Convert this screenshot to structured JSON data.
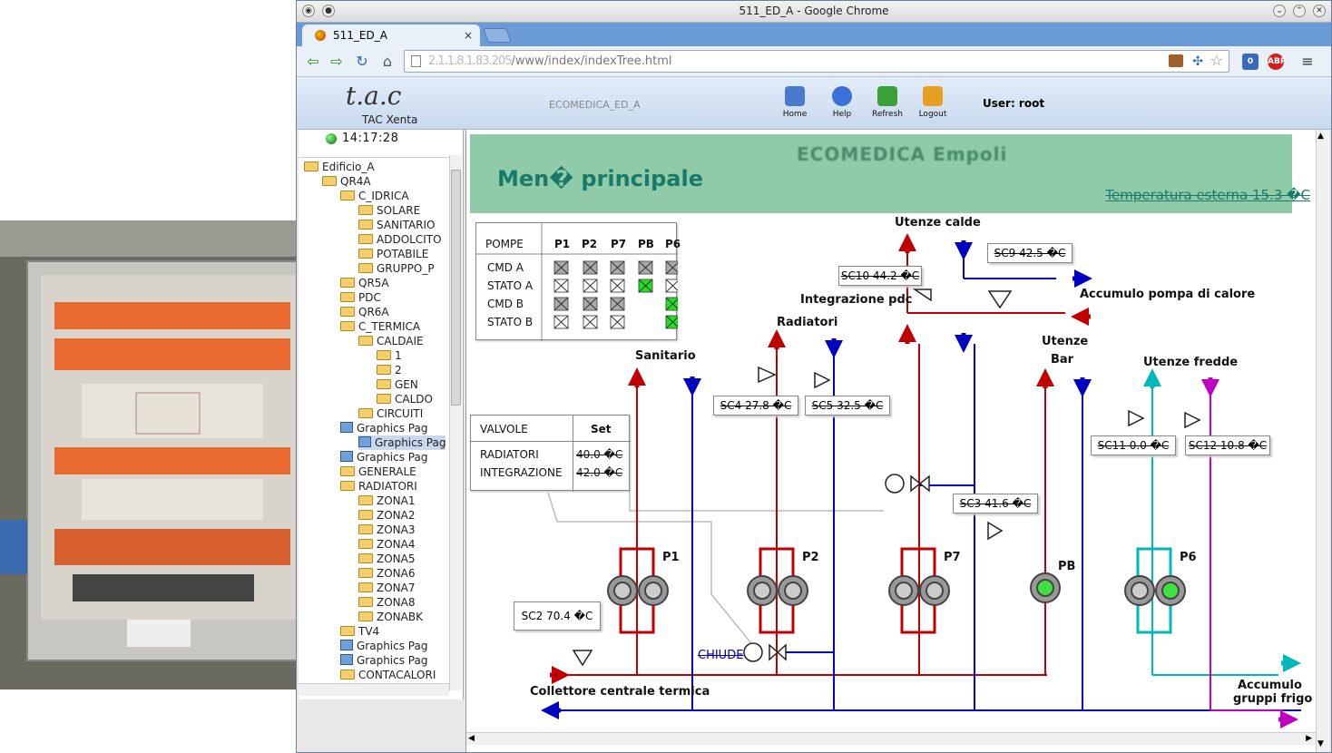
{
  "window": {
    "title": "511_ED_A - Google Chrome"
  },
  "tab": {
    "label": "511_ED_A",
    "close": "×"
  },
  "address": {
    "host": "2.1.1.8.1.83.205",
    "path": "/www/index/indexTree.html"
  },
  "extensions": {
    "badge": "0",
    "abp": "ABP"
  },
  "app": {
    "logo": "t.a.c",
    "subtitle": "TAC Xenta",
    "site_name": "ECOMEDICA_ED_A",
    "buttons": {
      "home": "Home",
      "help": "Help",
      "refresh": "Refresh",
      "logout": "Logout"
    },
    "user": "User: root"
  },
  "sidebar": {
    "clock": "14:17:28",
    "tree": [
      {
        "label": "Edificio_A",
        "type": "folder"
      },
      {
        "label": "QR4A",
        "type": "folder"
      },
      {
        "label": "C_IDRICA",
        "type": "folder"
      },
      {
        "label": "SOLARE",
        "type": "folder"
      },
      {
        "label": "SANITARIO",
        "type": "folder"
      },
      {
        "label": "ADDOLCITO",
        "type": "folder"
      },
      {
        "label": "POTABILE",
        "type": "folder"
      },
      {
        "label": "GRUPPO_P",
        "type": "folder"
      },
      {
        "label": "QR5A",
        "type": "folder"
      },
      {
        "label": "PDC",
        "type": "folder"
      },
      {
        "label": "QR6A",
        "type": "folder"
      },
      {
        "label": "C_TERMICA",
        "type": "folder"
      },
      {
        "label": "CALDAIE",
        "type": "folder"
      },
      {
        "label": "1",
        "type": "folder"
      },
      {
        "label": "2",
        "type": "folder"
      },
      {
        "label": "GEN",
        "type": "folder"
      },
      {
        "label": "CALDO",
        "type": "folder"
      },
      {
        "label": "CIRCUITI",
        "type": "folder"
      },
      {
        "label": "Graphics Pag",
        "type": "page"
      },
      {
        "label": "Graphics Pag",
        "type": "page"
      },
      {
        "label": "Graphics Pag",
        "type": "page"
      },
      {
        "label": "GENERALE",
        "type": "folder"
      },
      {
        "label": "RADIATORI",
        "type": "folder"
      },
      {
        "label": "ZONA1",
        "type": "folder"
      },
      {
        "label": "ZONA2",
        "type": "folder"
      },
      {
        "label": "ZONA3",
        "type": "folder"
      },
      {
        "label": "ZONA4",
        "type": "folder"
      },
      {
        "label": "ZONA5",
        "type": "folder"
      },
      {
        "label": "ZONA6",
        "type": "folder"
      },
      {
        "label": "ZONA7",
        "type": "folder"
      },
      {
        "label": "ZONA8",
        "type": "folder"
      },
      {
        "label": "ZONABK",
        "type": "folder"
      },
      {
        "label": "TV4",
        "type": "folder"
      },
      {
        "label": "Graphics Pag",
        "type": "page"
      },
      {
        "label": "Graphics Pag",
        "type": "page"
      },
      {
        "label": "CONTACALORI",
        "type": "folder"
      }
    ]
  },
  "scada": {
    "banner_title": "ECOMEDICA Empoli",
    "menu_title": "Men� principale",
    "outside_temp": "Temperatura esterna 15.3 �C",
    "pumps_table": {
      "header": [
        "POMPE",
        "P1",
        "P2",
        "P7",
        "PB",
        "P6"
      ],
      "rows": [
        "CMD A",
        "STATO A",
        "CMD B",
        "STATO B"
      ]
    },
    "valves_table": {
      "header_left": "VALVOLE",
      "header_right": "Set",
      "rows": [
        {
          "name": "RADIATORI",
          "value": "40.0 �C"
        },
        {
          "name": "INTEGRAZIONE",
          "value": "42.0 �C"
        }
      ]
    },
    "labels": {
      "utenze_calde": "Utenze calde",
      "accumulo_pdc": "Accumulo pompa di calore",
      "integrazione": "Integrazione pdc",
      "radiatori": "Radiatori",
      "sanitario": "Sanitario",
      "utenze_bar_1": "Utenze",
      "utenze_bar_2": "Bar",
      "utenze_fredde": "Utenze fredde",
      "collettore": "Collettore centrale termica",
      "accumulo_frigo_1": "Accumulo",
      "accumulo_frigo_2": "gruppi frigo",
      "chiude": "CHIUDE"
    },
    "sensors": {
      "sc10": "SC10 44.2 �C",
      "sc9": "SC9 42.5 �C",
      "sc4": "SC4 27.8 �C",
      "sc5": "SC5 32.5 �C",
      "sc3": "SC3 41.6 �C",
      "sc11": "SC11 0.0 �C",
      "sc12": "SC12 10.8 �C",
      "sc2": "SC2 70.4 �C"
    },
    "pumps": {
      "p1": "P1",
      "p2": "P2",
      "p7": "P7",
      "pb": "PB",
      "p6": "P6"
    },
    "colors": {
      "hot": "#c00000",
      "return": "#0000c0",
      "cold": "#00b8b8",
      "frigo": "#c000c0",
      "banner": "#8fcba8",
      "ok": "#20e020"
    }
  }
}
